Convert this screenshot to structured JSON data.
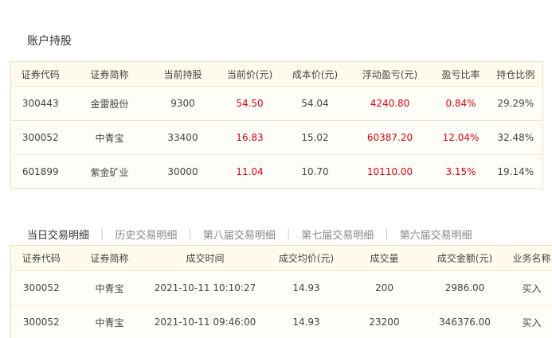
{
  "holdings": {
    "title": "账户持股",
    "headers": [
      "证券代码",
      "证券简称",
      "当前持股",
      "当前价(元)",
      "成本价(元)",
      "浮动盈亏(元)",
      "盈亏比率",
      "持仓比例"
    ],
    "rows": [
      {
        "code": "300443",
        "name": "金雷股份",
        "shares": "9300",
        "price": "54.50",
        "cost": "54.04",
        "pnl": "4240.80",
        "ratio": "0.84%",
        "weight": "29.29%"
      },
      {
        "code": "300052",
        "name": "中青宝",
        "shares": "33400",
        "price": "16.83",
        "cost": "15.02",
        "pnl": "60387.20",
        "ratio": "12.04%",
        "weight": "32.48%"
      },
      {
        "code": "601899",
        "name": "紫金矿业",
        "shares": "30000",
        "price": "11.04",
        "cost": "10.70",
        "pnl": "10110.00",
        "ratio": "3.15%",
        "weight": "19.14%"
      }
    ]
  },
  "tabs": [
    "当日交易明细",
    "历史交易明细",
    "第八届交易明细",
    "第七届交易明细",
    "第六届交易明细"
  ],
  "tab_separator": "|",
  "trades": {
    "headers": [
      "证券代码",
      "证券简称",
      "成交时间",
      "成交均价(元)",
      "成交量",
      "成交金额(元)",
      "业务名称"
    ],
    "rows": [
      {
        "code": "300052",
        "name": "中青宝",
        "time": "2021-10-11 10:10:27",
        "avg_price": "14.93",
        "volume": "200",
        "amount": "2986.00",
        "type": "买入"
      },
      {
        "code": "300052",
        "name": "中青宝",
        "time": "2021-10-11 09:46:00",
        "avg_price": "14.93",
        "volume": "23200",
        "amount": "346376.00",
        "type": "买入"
      }
    ]
  },
  "colors": {
    "accent_red": "#e60012",
    "border": "#eadfbf",
    "header_bg": "#fefaec"
  }
}
